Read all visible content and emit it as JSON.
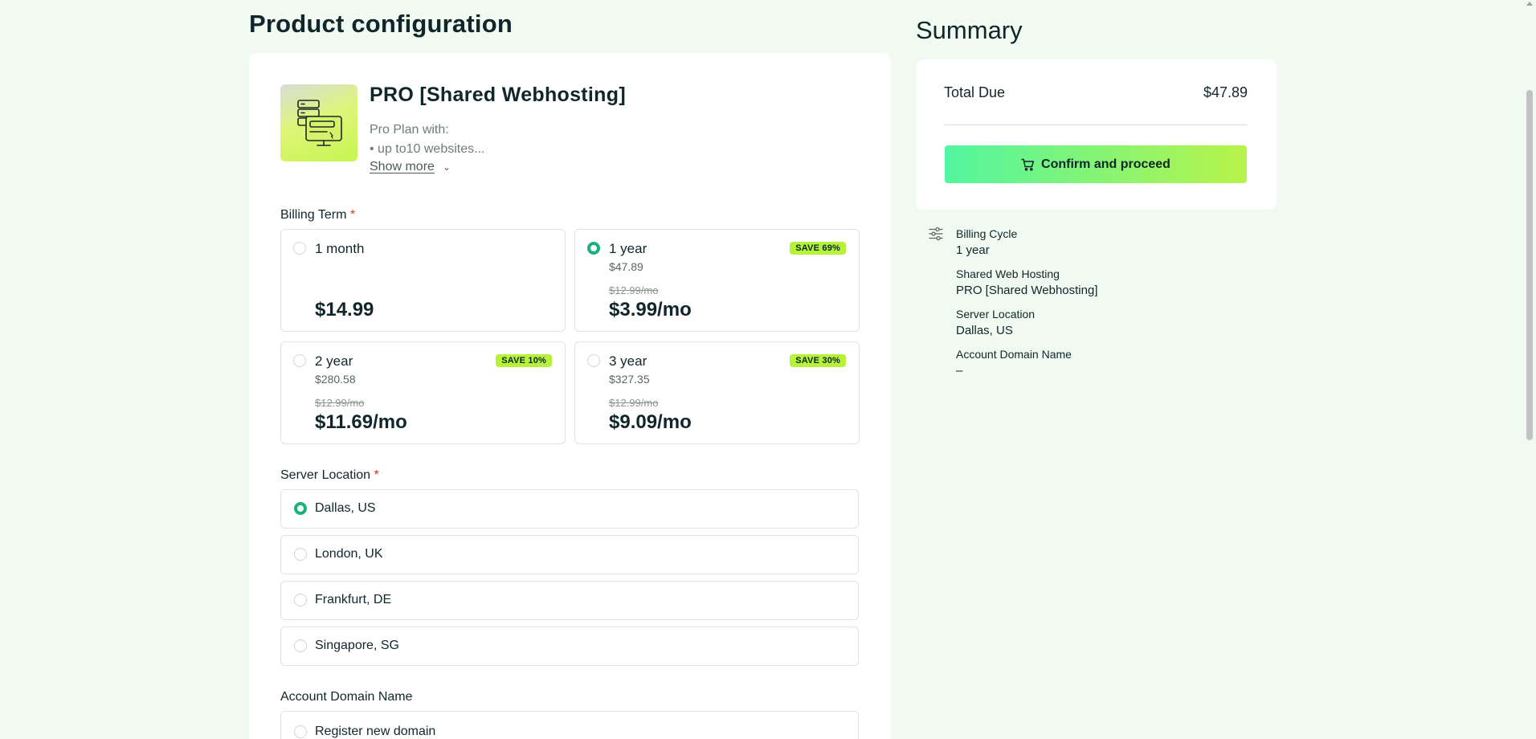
{
  "header": {
    "title_regular": "Product",
    "title_bold": "configuration"
  },
  "product": {
    "icon": "server-monitor-icon",
    "name": "PRO [Shared Webhosting]",
    "desc_line1": "Pro Plan with:",
    "desc_line2": "• up to10 websites...",
    "show_more": "Show more"
  },
  "billing": {
    "label": "Billing Term",
    "required": "*",
    "options": [
      {
        "name": "1 month",
        "sub": "",
        "strike": "",
        "price": "$14.99",
        "badge": "",
        "selected": false
      },
      {
        "name": "1 year",
        "sub": "$47.89",
        "strike": "$12.99/mo",
        "price": "$3.99/mo",
        "badge": "SAVE 69%",
        "selected": true
      },
      {
        "name": "2 year",
        "sub": "$280.58",
        "strike": "$12.99/mo",
        "price": "$11.69/mo",
        "badge": "SAVE 10%",
        "selected": false
      },
      {
        "name": "3 year",
        "sub": "$327.35",
        "strike": "$12.99/mo",
        "price": "$9.09/mo",
        "badge": "SAVE 30%",
        "selected": false
      }
    ]
  },
  "location": {
    "label": "Server Location",
    "required": "*",
    "options": [
      {
        "label": "Dallas, US",
        "selected": true
      },
      {
        "label": "London, UK",
        "selected": false
      },
      {
        "label": "Frankfurt, DE",
        "selected": false
      },
      {
        "label": "Singapore, SG",
        "selected": false
      }
    ]
  },
  "domain": {
    "label": "Account Domain Name",
    "options": [
      {
        "label": "Register new domain",
        "selected": false
      }
    ]
  },
  "summary": {
    "title": "Summary",
    "total_label": "Total Due",
    "total_value": "$47.89",
    "confirm_label": "Confirm and proceed",
    "icon": "sliders-icon",
    "items": [
      {
        "key": "Billing Cycle",
        "value": "1 year"
      },
      {
        "key": "Shared Web Hosting",
        "value": "PRO [Shared Webhosting]"
      },
      {
        "key": "Server Location",
        "value": "Dallas, US"
      },
      {
        "key": "Account Domain Name",
        "value": "–"
      }
    ]
  },
  "colors": {
    "background": "#f0faf0",
    "accent_green": "#1ab07a",
    "badge": "#b7f23a",
    "button_gradient_start": "#52f5a0",
    "button_gradient_end": "#b8f44a",
    "required": "#e0342f"
  }
}
